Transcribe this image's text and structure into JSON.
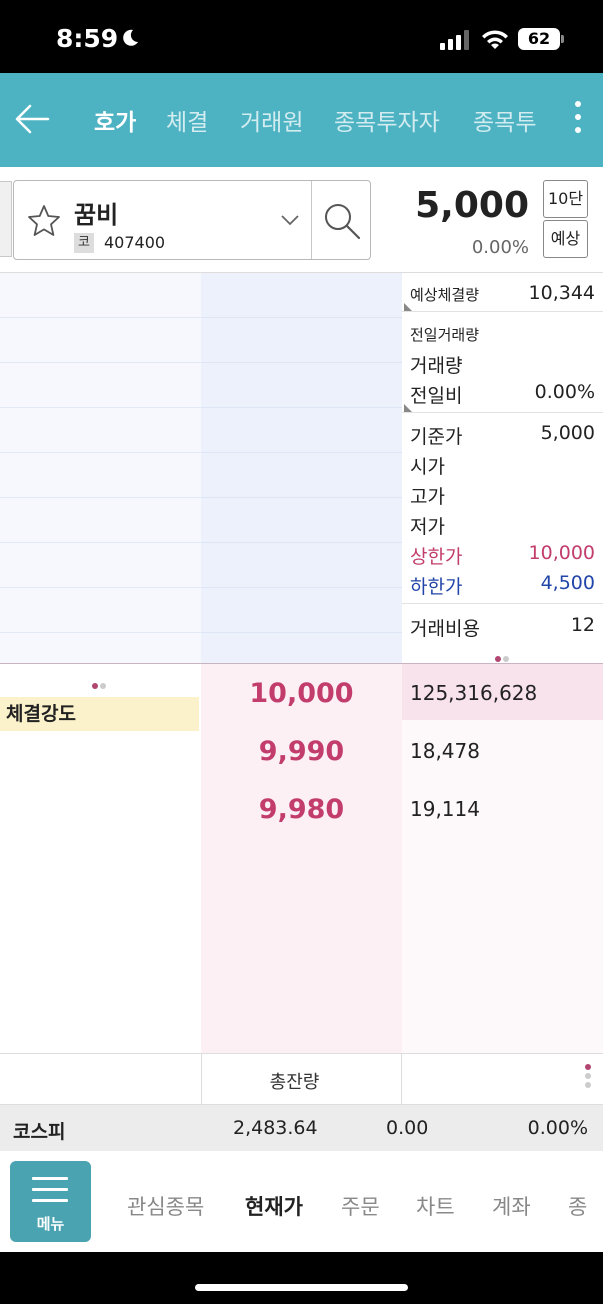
{
  "status": {
    "time": "8:59",
    "battery": "62"
  },
  "top_nav": {
    "tabs": [
      "호가",
      "체결",
      "거래원",
      "종목투자자",
      "종목투"
    ]
  },
  "stock": {
    "name": "꿈비",
    "code_badge": "코",
    "code": "407400",
    "price": "5,000",
    "change": "0.00%",
    "btn_depth": "10단",
    "btn_expected": "예상"
  },
  "info": {
    "expected_qty_label": "예상체결량",
    "expected_qty": "10,344",
    "prev_volume_label": "전일거래량",
    "volume_label": "거래량",
    "vs_prev_label": "전일비",
    "vs_prev": "0.00%",
    "base_label": "기준가",
    "base": "5,000",
    "open_label": "시가",
    "high_label": "고가",
    "low_label": "저가",
    "upper_limit_label": "상한가",
    "upper_limit": "10,000",
    "lower_limit_label": "하한가",
    "lower_limit": "4,500",
    "fee_label": "거래비용",
    "fee": "12"
  },
  "orderbook": {
    "strength_label": "체결강도",
    "bids": [
      {
        "price": "10,000",
        "qty": "125,316,628"
      },
      {
        "price": "9,990",
        "qty": "18,478"
      },
      {
        "price": "9,980",
        "qty": "19,114"
      }
    ],
    "total_label": "총잔량"
  },
  "index_row": {
    "name": "코스피",
    "value": "2,483.64",
    "change": "0.00",
    "rate": "0.00%"
  },
  "bottom_nav": {
    "menu_label": "메뉴",
    "items": [
      "관심종목",
      "현재가",
      "주문",
      "차트",
      "계좌",
      "종"
    ]
  },
  "colors": {
    "accent": "#4db3c3",
    "up": "#c23d6c",
    "down": "#2145a8"
  }
}
